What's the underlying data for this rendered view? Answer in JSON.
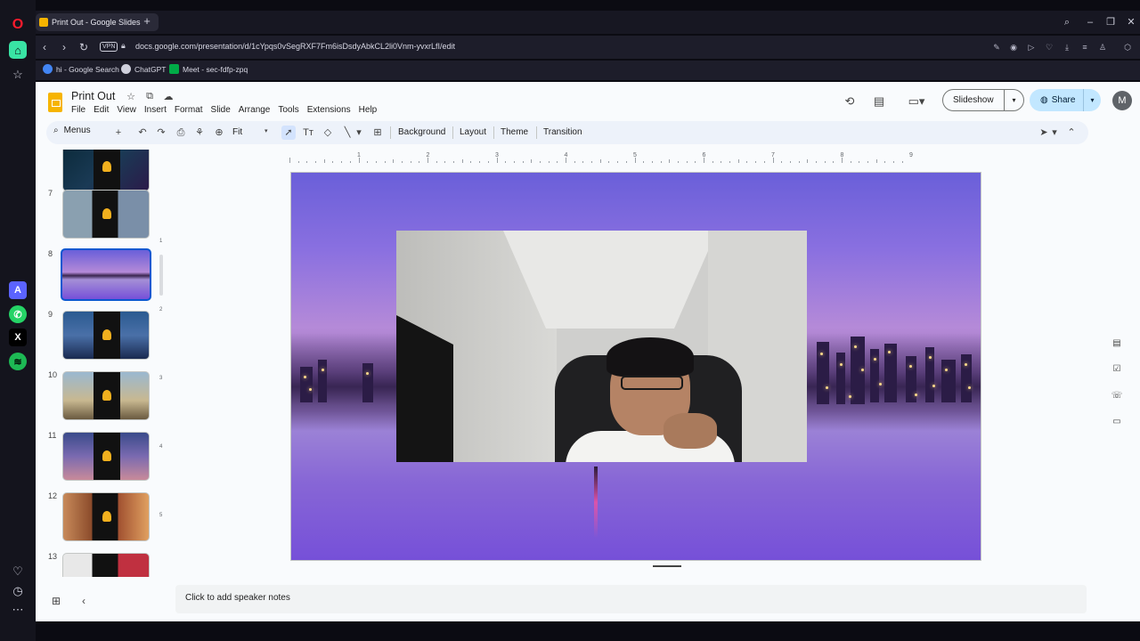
{
  "browser": {
    "tab_title": "Print Out - Google Slides",
    "url": "docs.google.com/presentation/d/1cYpqs0vSegRXF7Fm6isDsdyAbkCL2li0Vnm-yvxrLfI/edit",
    "vpn_label": "VPN",
    "bookmarks": [
      {
        "label": "hi - Google Search",
        "color": "#4285f4"
      },
      {
        "label": "ChatGPT",
        "color": "#cfd0dc"
      },
      {
        "label": "Meet - sec-fdfp-zpq",
        "color": "#00ac47"
      }
    ]
  },
  "doc": {
    "title": "Print Out",
    "menus": [
      "File",
      "Edit",
      "View",
      "Insert",
      "Format",
      "Slide",
      "Arrange",
      "Tools",
      "Extensions",
      "Help"
    ],
    "slideshow_label": "Slideshow",
    "share_label": "Share",
    "avatar_initial": "M"
  },
  "toolbar": {
    "search_label": "Menus",
    "zoom_label": "Fit",
    "background_label": "Background",
    "layout_label": "Layout",
    "theme_label": "Theme",
    "transition_label": "Transition"
  },
  "filmstrip": {
    "slides": [
      {
        "num": "",
        "theme": "night"
      },
      {
        "num": "7",
        "theme": "statue"
      },
      {
        "num": "8",
        "theme": "purple",
        "selected": true
      },
      {
        "num": "9",
        "theme": "city-night"
      },
      {
        "num": "10",
        "theme": "savanna"
      },
      {
        "num": "11",
        "theme": "city-dusk"
      },
      {
        "num": "12",
        "theme": "market"
      },
      {
        "num": "13",
        "theme": "red"
      }
    ]
  },
  "ruler": {
    "h_labels": [
      "1",
      "2",
      "3",
      "4",
      "5",
      "6",
      "7",
      "8",
      "9"
    ],
    "v_labels": [
      "1",
      "2",
      "3",
      "4",
      "5"
    ]
  },
  "notes": {
    "placeholder": "Click to add speaker notes"
  },
  "colors": {
    "accent": "#0b57d0",
    "share_bg": "#c2e7ff",
    "slides_yellow": "#f6b400"
  }
}
